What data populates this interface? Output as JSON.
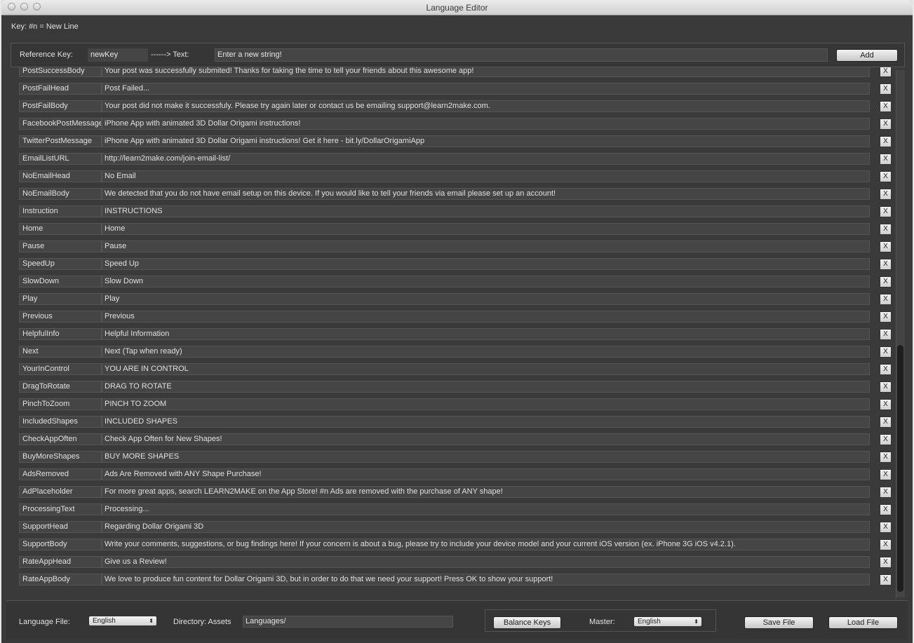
{
  "window": {
    "title": "Language Editor"
  },
  "key_hint": "Key:  #n = New Line",
  "reference": {
    "key_label": "Reference Key:",
    "key_value": "newKey",
    "arrow_label": "------> Text:",
    "text_placeholder": "Enter a new string!",
    "add_label": "Add"
  },
  "rows": [
    {
      "key": "PostSuccessBody",
      "value": "Your post was successfully submited! Thanks for taking the time to tell your friends about this awesome app!"
    },
    {
      "key": "PostFailHead",
      "value": "Post Failed..."
    },
    {
      "key": "PostFailBody",
      "value": "Your post did not make it successfuly. Please try again later or contact us be emailing support@learn2make.com."
    },
    {
      "key": "FacebookPostMessage",
      "value": "iPhone App with animated 3D Dollar Origami instructions!"
    },
    {
      "key": "TwitterPostMessage",
      "value": "iPhone App with animated 3D Dollar Origami instructions! Get it here - bit.ly/DollarOrigamiApp"
    },
    {
      "key": "EmailListURL",
      "value": "http://learn2make.com/join-email-list/"
    },
    {
      "key": "NoEmailHead",
      "value": "No Email"
    },
    {
      "key": "NoEmailBody",
      "value": "We detected that you do not have email setup on this device. If you would like to tell your friends via email please set up an account!"
    },
    {
      "key": "Instruction",
      "value": "INSTRUCTIONS"
    },
    {
      "key": "Home",
      "value": "Home"
    },
    {
      "key": "Pause",
      "value": "Pause"
    },
    {
      "key": "SpeedUp",
      "value": "Speed Up"
    },
    {
      "key": "SlowDown",
      "value": "Slow Down"
    },
    {
      "key": "Play",
      "value": "Play"
    },
    {
      "key": "Previous",
      "value": "Previous"
    },
    {
      "key": "HelpfulInfo",
      "value": "Helpful Information"
    },
    {
      "key": "Next",
      "value": "Next (Tap when ready)"
    },
    {
      "key": "YourInControl",
      "value": "YOU ARE IN CONTROL"
    },
    {
      "key": "DragToRotate",
      "value": "DRAG TO ROTATE"
    },
    {
      "key": "PinchToZoom",
      "value": "PINCH TO ZOOM"
    },
    {
      "key": "IncludedShapes",
      "value": "INCLUDED SHAPES"
    },
    {
      "key": "CheckAppOften",
      "value": "Check App Often for New Shapes!"
    },
    {
      "key": "BuyMoreShapes",
      "value": "BUY MORE SHAPES"
    },
    {
      "key": "AdsRemoved",
      "value": "Ads Are Removed with ANY Shape Purchase!"
    },
    {
      "key": "AdPlaceholder",
      "value": "For more great apps, search LEARN2MAKE on the App Store! #n Ads are removed with the purchase of ANY shape!"
    },
    {
      "key": "ProcessingText",
      "value": "Processing..."
    },
    {
      "key": "SupportHead",
      "value": "Regarding Dollar Origami 3D"
    },
    {
      "key": "SupportBody",
      "value": "Write your comments, suggestions, or bug findings here! If your concern is about a bug, please try to include your device model and your current iOS version (ex. iPhone 3G iOS v4.2.1)."
    },
    {
      "key": "RateAppHead",
      "value": "Give us a Review!"
    },
    {
      "key": "RateAppBody",
      "value": "We love to produce fun content for Dollar Origami 3D, but in order to do that we need your support! Press OK to show your support!"
    }
  ],
  "delete_label": "X",
  "bottom": {
    "language_file_label": "Language File:",
    "language_file_value": "English",
    "directory_label": "Directory: Assets",
    "directory_value": "Languages/",
    "balance_label": "Balance Keys",
    "master_label": "Master:",
    "master_value": "English",
    "save_label": "Save File",
    "load_label": "Load File"
  }
}
